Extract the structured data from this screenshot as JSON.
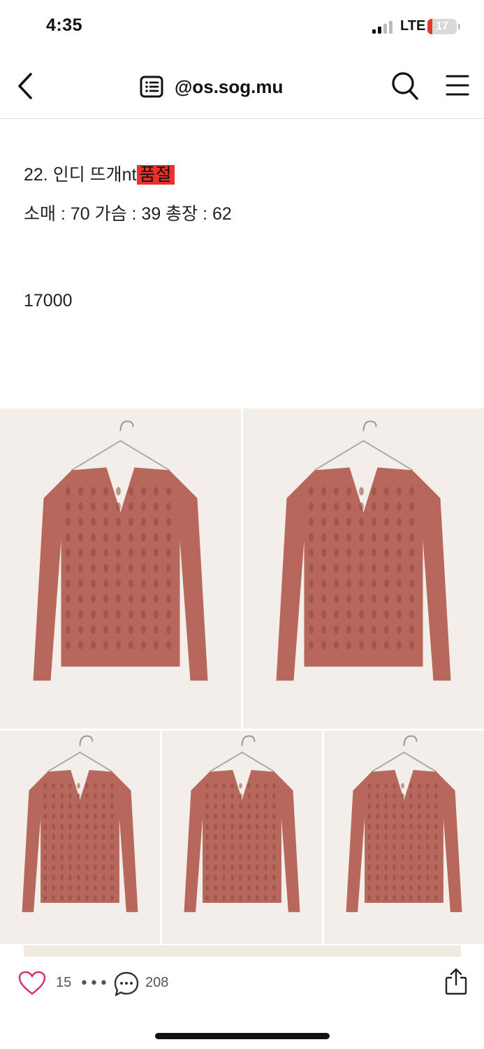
{
  "status_bar": {
    "time": "4:35",
    "network": "LTE",
    "battery_level": "17",
    "battery_fraction": 0.17,
    "battery_color": "#e23a2c"
  },
  "header": {
    "title": "@os.sog.mu",
    "icons": [
      "chevron-left-icon",
      "list-icon",
      "search-icon",
      "menu-icon"
    ]
  },
  "post": {
    "title_line": "22. 인디 뜨개nt",
    "soldout_label": "품절",
    "measurements": "소매 : 70 가슴 : 39 총장 : 62",
    "price": "17000",
    "soldout_color": "#e8322b"
  },
  "photos": [
    {
      "name": "sweater-front-photo-1"
    },
    {
      "name": "sweater-front-photo-2"
    },
    {
      "name": "sweater-closeup-photo"
    },
    {
      "name": "sweater-held-photo"
    },
    {
      "name": "sweater-back-photo"
    }
  ],
  "actions": {
    "like_count": "15",
    "more_label": "•••",
    "comment_count": "208",
    "icons": [
      "heart-icon",
      "more-icon",
      "comment-icon",
      "share-icon"
    ],
    "heart_color": "#d9337a"
  },
  "colors": {
    "sweater": "#b8675c",
    "background": "#f3eee9"
  }
}
